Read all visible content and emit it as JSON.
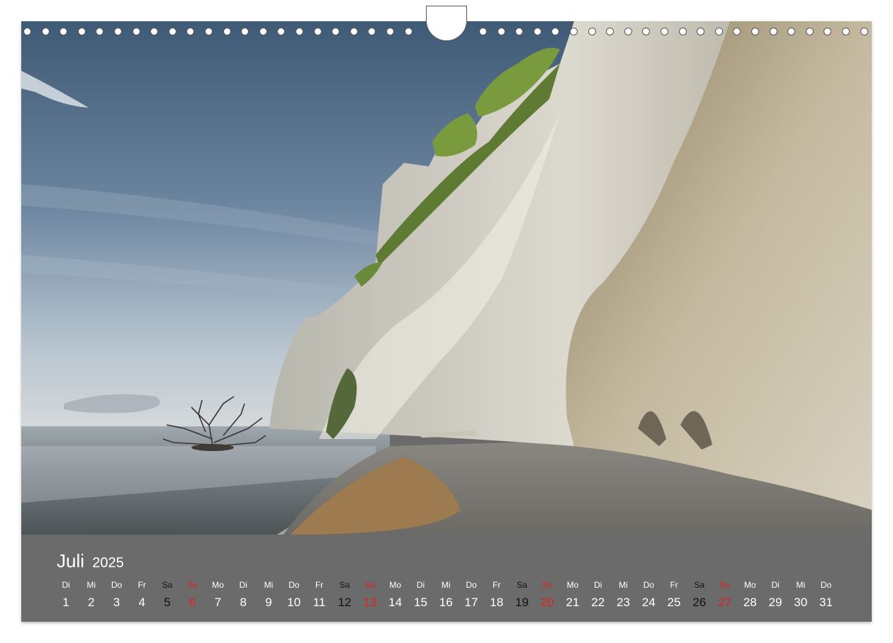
{
  "calendar": {
    "month": "Juli",
    "year": "2025",
    "days": [
      {
        "weekday": "Di",
        "day": "1",
        "kind": "weekday"
      },
      {
        "weekday": "Mi",
        "day": "2",
        "kind": "weekday"
      },
      {
        "weekday": "Do",
        "day": "3",
        "kind": "weekday"
      },
      {
        "weekday": "Fr",
        "day": "4",
        "kind": "weekday"
      },
      {
        "weekday": "Sa",
        "day": "5",
        "kind": "saturday"
      },
      {
        "weekday": "So",
        "day": "6",
        "kind": "sunday"
      },
      {
        "weekday": "Mo",
        "day": "7",
        "kind": "weekday"
      },
      {
        "weekday": "Di",
        "day": "8",
        "kind": "weekday"
      },
      {
        "weekday": "Mi",
        "day": "9",
        "kind": "weekday"
      },
      {
        "weekday": "Do",
        "day": "10",
        "kind": "weekday"
      },
      {
        "weekday": "Fr",
        "day": "11",
        "kind": "weekday"
      },
      {
        "weekday": "Sa",
        "day": "12",
        "kind": "saturday"
      },
      {
        "weekday": "So",
        "day": "13",
        "kind": "sunday"
      },
      {
        "weekday": "Mo",
        "day": "14",
        "kind": "weekday"
      },
      {
        "weekday": "Di",
        "day": "15",
        "kind": "weekday"
      },
      {
        "weekday": "Mi",
        "day": "16",
        "kind": "weekday"
      },
      {
        "weekday": "Do",
        "day": "17",
        "kind": "weekday"
      },
      {
        "weekday": "Fr",
        "day": "18",
        "kind": "weekday"
      },
      {
        "weekday": "Sa",
        "day": "19",
        "kind": "saturday"
      },
      {
        "weekday": "So",
        "day": "20",
        "kind": "sunday"
      },
      {
        "weekday": "Mo",
        "day": "21",
        "kind": "weekday"
      },
      {
        "weekday": "Di",
        "day": "22",
        "kind": "weekday"
      },
      {
        "weekday": "Mi",
        "day": "23",
        "kind": "weekday"
      },
      {
        "weekday": "Do",
        "day": "24",
        "kind": "weekday"
      },
      {
        "weekday": "Fr",
        "day": "25",
        "kind": "weekday"
      },
      {
        "weekday": "Sa",
        "day": "26",
        "kind": "saturday"
      },
      {
        "weekday": "So",
        "day": "27",
        "kind": "sunday"
      },
      {
        "weekday": "Mo",
        "day": "28",
        "kind": "weekday"
      },
      {
        "weekday": "Di",
        "day": "29",
        "kind": "weekday"
      },
      {
        "weekday": "Mi",
        "day": "30",
        "kind": "weekday"
      },
      {
        "weekday": "Do",
        "day": "31",
        "kind": "weekday"
      }
    ]
  },
  "colors": {
    "footer_background": "#6b6b6b",
    "weekday_text": "#ffffff",
    "saturday_text": "#111111",
    "sunday_text": "#e0231c"
  }
}
